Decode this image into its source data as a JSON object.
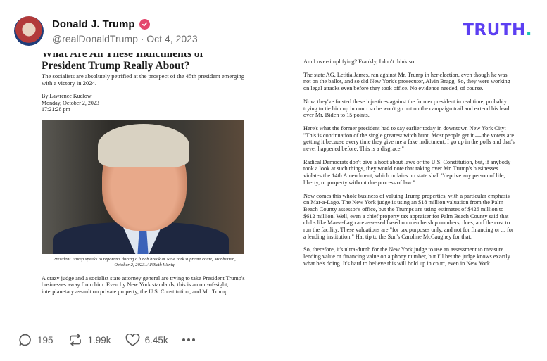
{
  "post": {
    "author_name": "Donald J. Trump",
    "handle_date": "@realDonaldTrump · Oct 4, 2023",
    "platform_logo_main": "TRUTH",
    "platform_logo_dot": "."
  },
  "article": {
    "headline_line1": "What Are All These Indictments of",
    "headline_line2": "President Trump Really About?",
    "subhead": "The socialists are absolutely petrified at the prospect of the 45th president emerging with a victory in 2024.",
    "byline_author": "By Lawrence Kudlow",
    "byline_date": "Monday, October 2, 2023",
    "byline_time": "17:21:28 pm",
    "caption": "President Trump speaks to reporters during a lunch break at New York supreme court, Manhattan, October 2, 2023. AP/Seth Wenig",
    "left_paragraph": "A crazy judge and a socialist state attorney general are trying to take President Trump's businesses away from him. Even by New York standards, this is an out-of-sight, interplanetary assault on private property, the U.S. Constitution, and Mr. Trump.",
    "right_paragraphs": [
      "Am I oversimplifying? Frankly, I don't think so.",
      "The state AG, Letitia James, ran against Mr. Trump in her election, even though he was not on the ballot, and so did New York's prosecutor, Alvin Bragg. So, they were working on legal attacks even before they took office. No evidence needed, of course.",
      "Now, they've foisted these injustices against the former president in real time, probably trying to tie him up in court so he won't go out on the campaign trail and extend his lead over Mr. Biden to 15 points.",
      "Here's what the former president had to say earlier today in downtown New York City: \"This is continuation of the single greatest witch hunt. Most people get it — the voters are getting it because every time they give me a fake indictment, I go up in the polls and that's never happened before. This is a disgrace.\"",
      "Radical Democrats don't give a hoot about laws or the U.S. Constitution, but, if anybody took a look at such things, they would note that taking over Mr. Trump's businesses violates the 14th Amendment, which ordains no state shall \"deprive any person of life, liberty, or property without due process of law.\"",
      "Now comes this whole business of valuing Trump properties, with a particular emphasis on Mar-a-Lago. The New York judge is using an $18 million valuation from the Palm Beach County assessor's office, but the Trumps are using estimates of $426 million to $612 million. Well, even a chief property tax appraiser for Palm Beach County said that clubs like Mar-a-Lago are assessed based on membership numbers, dues, and the cost to run the facility. These valuations are \"for tax purposes only, and not for financing or ... for a lending institution.\" Hat tip to the Sun's Caroline McCaughey for that.",
      "So, therefore, it's ultra-dumb for the New York judge to use an assessment to measure lending value or financing value on a phony number, but I'll bet the judge knows exactly what he's doing. It's hard to believe this will hold up in court, even in New York."
    ]
  },
  "actions": {
    "replies": "195",
    "retruths": "1.99k",
    "likes": "6.45k"
  },
  "colors": {
    "logo": "#5c3ff2",
    "logo_dot": "#18c4b0",
    "verified": "#e4476d",
    "muted": "#6b6b6b"
  },
  "icons": [
    "verified-badge-icon",
    "reply-icon",
    "retruth-icon",
    "like-icon",
    "more-icon"
  ]
}
